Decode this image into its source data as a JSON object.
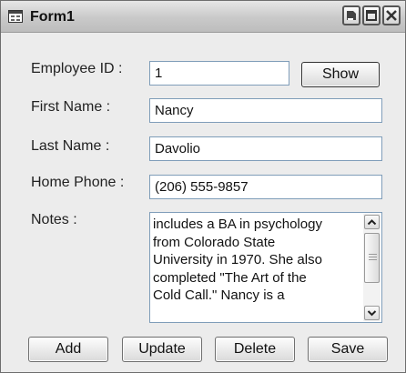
{
  "window": {
    "title": "Form1"
  },
  "labels": {
    "employee_id": "Employee ID :",
    "first_name": "First Name :",
    "last_name": "Last Name :",
    "home_phone": "Home Phone :",
    "notes": "Notes :"
  },
  "fields": {
    "employee_id": "1",
    "first_name": "Nancy",
    "last_name": "Davolio",
    "home_phone": "(206) 555-9857",
    "notes": "includes a BA in psychology\nfrom Colorado State\nUniversity in 1970. She also\ncompleted \"The Art of the\nCold Call.\" Nancy is a"
  },
  "buttons": {
    "show": "Show",
    "add": "Add",
    "update": "Update",
    "delete": "Delete",
    "save": "Save"
  },
  "icons": {
    "app": "form-window-icon",
    "minimize": "minimize-icon",
    "maximize": "maximize-icon",
    "close": "close-icon",
    "scroll_up": "chevron-up-icon",
    "scroll_down": "chevron-down-icon"
  }
}
